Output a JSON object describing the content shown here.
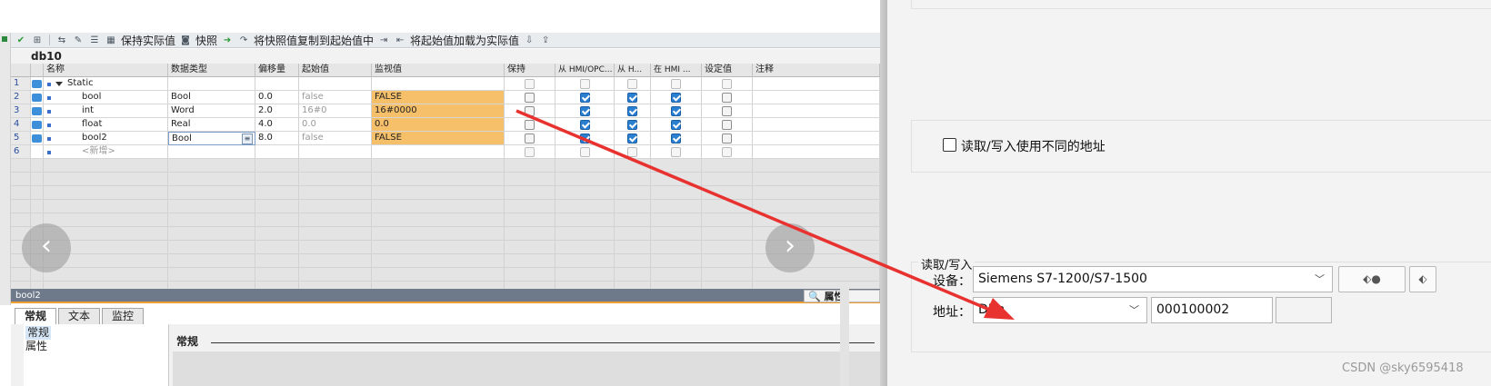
{
  "toolbar": {
    "keep_actual": "保持实际值",
    "snapshot": "快照",
    "copy_snapshot": "将快照值复制到起始值中",
    "load_start": "将起始值加载为实际值"
  },
  "db_title": "db10",
  "columns": [
    "名称",
    "数据类型",
    "偏移量",
    "起始值",
    "监视值",
    "保持",
    "从 HMI/OPC...",
    "从 H...",
    "在 HMI ...",
    "设定值",
    "注释"
  ],
  "rows": [
    {
      "num": "1",
      "name": "Static",
      "type": "",
      "offset": "",
      "start": "",
      "monitor": "",
      "retain": false,
      "hmi_access": false,
      "hmi_write": false,
      "hmi_visible": false,
      "setpoint": false,
      "kind": "section"
    },
    {
      "num": "2",
      "name": "bool",
      "type": "Bool",
      "offset": "0.0",
      "start": "false",
      "monitor": "FALSE",
      "retain": false,
      "hmi_access": true,
      "hmi_write": true,
      "hmi_visible": true,
      "setpoint": false,
      "kind": "var"
    },
    {
      "num": "3",
      "name": "int",
      "type": "Word",
      "offset": "2.0",
      "start": "16#0",
      "monitor": "16#0000",
      "retain": false,
      "hmi_access": true,
      "hmi_write": true,
      "hmi_visible": true,
      "setpoint": false,
      "kind": "var"
    },
    {
      "num": "4",
      "name": "float",
      "type": "Real",
      "offset": "4.0",
      "start": "0.0",
      "monitor": "0.0",
      "retain": false,
      "hmi_access": true,
      "hmi_write": true,
      "hmi_visible": true,
      "setpoint": false,
      "kind": "var"
    },
    {
      "num": "5",
      "name": "bool2",
      "type": "Bool",
      "offset": "8.0",
      "start": "false",
      "monitor": "FALSE",
      "retain": false,
      "hmi_access": true,
      "hmi_write": true,
      "hmi_visible": true,
      "setpoint": false,
      "kind": "editing"
    },
    {
      "num": "6",
      "name": "<新增>",
      "type": "",
      "offset": "",
      "start": "",
      "monitor": "",
      "kind": "new"
    }
  ],
  "nav": {
    "prev": "‹",
    "next": "›"
  },
  "inspector": {
    "title": "bool2",
    "properties_tab": "属性",
    "tabs": [
      "常规",
      "文本",
      "监控"
    ],
    "nav_items": [
      "常规",
      "属性"
    ],
    "section_title": "常规"
  },
  "dialog": {
    "different_address_label": "读取/写入使用不同的地址",
    "rw_group_label": "读取/写入",
    "device_label": "设备：",
    "device_value": "Siemens S7-1200/S7-1500",
    "address_label": "地址：",
    "address_type": "DBn",
    "address_value": "000100002",
    "address_extra": ""
  },
  "colors": {
    "monitor_highlight": "#f6c06a",
    "arrow": "#e8322f",
    "checkbox_on": "#2a7fd0"
  },
  "watermark": "CSDN @sky6595418"
}
